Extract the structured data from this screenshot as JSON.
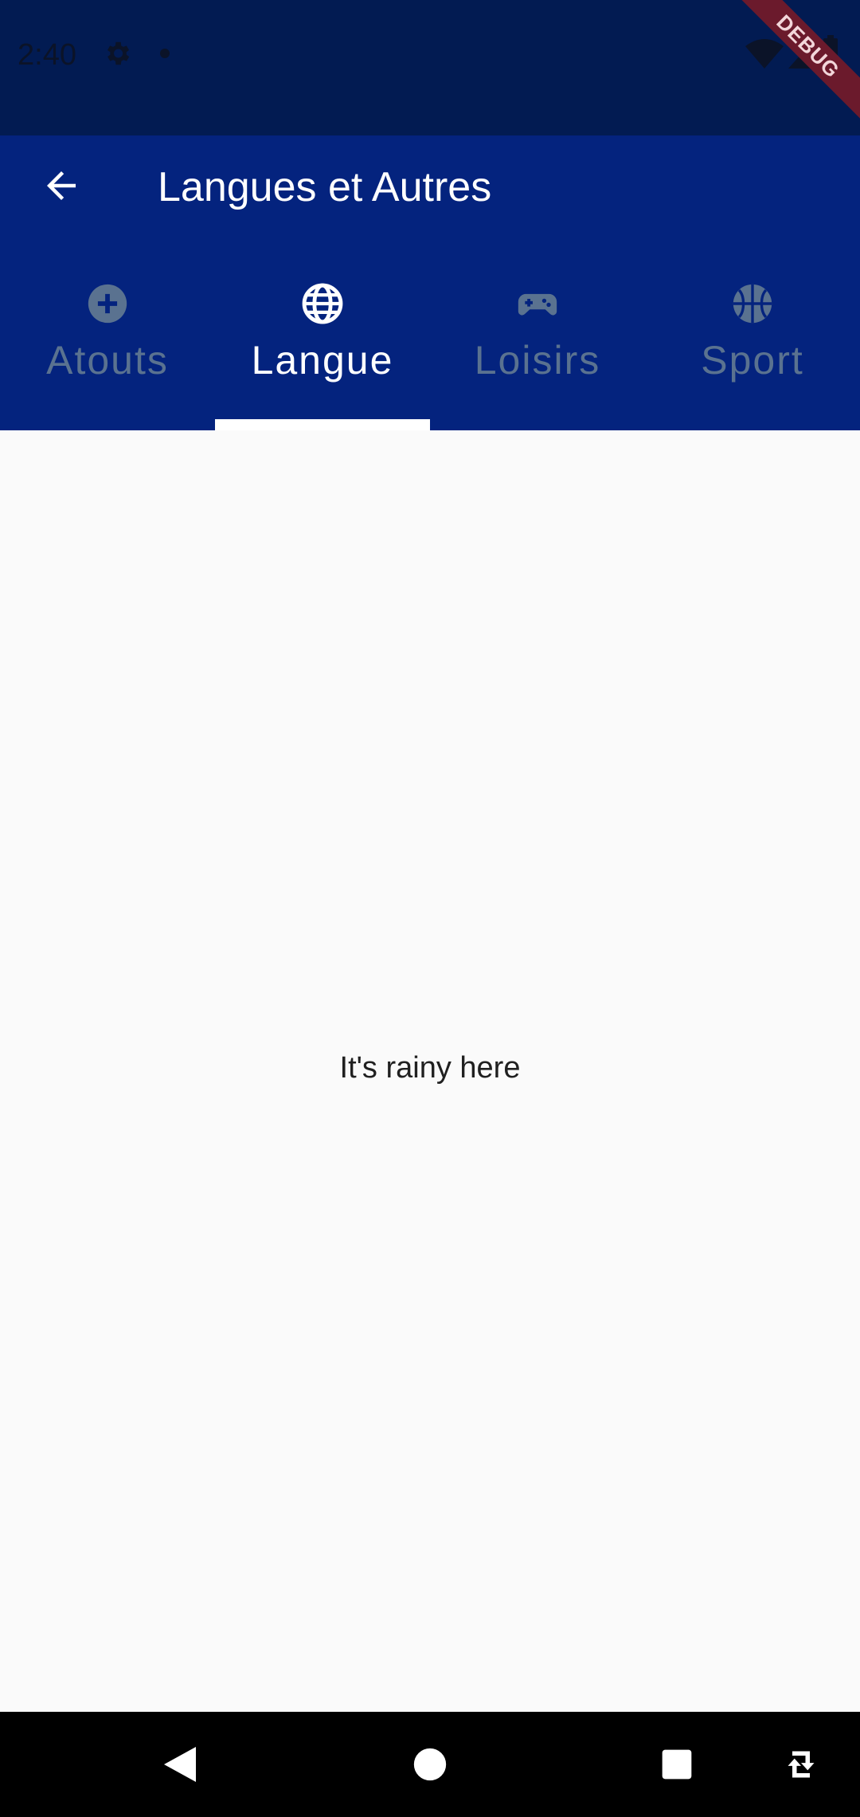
{
  "status_bar": {
    "time": "2:40",
    "icons": [
      "gear-icon",
      "notification-dot-icon",
      "wifi-off-icon",
      "signal-icon",
      "battery-icon"
    ]
  },
  "debug_banner": {
    "label": "DEBUG"
  },
  "app_bar": {
    "title": "Langues et Autres",
    "back_icon": "arrow-back-icon",
    "background_color": "#04237e",
    "tabs": [
      {
        "label": "Atouts",
        "icon": "add-circle-icon",
        "selected": false
      },
      {
        "label": "Langue",
        "icon": "globe-icon",
        "selected": true
      },
      {
        "label": "Loisirs",
        "icon": "gamepad-icon",
        "selected": false
      },
      {
        "label": "Sport",
        "icon": "basketball-icon",
        "selected": false
      }
    ],
    "active_color": "#ffffff",
    "inactive_color": "#5a7290"
  },
  "body": {
    "message": "It's rainy here"
  },
  "nav_bar": {
    "buttons": [
      "back-triangle-icon",
      "home-circle-icon",
      "recents-square-icon",
      "rotate-icon"
    ]
  }
}
